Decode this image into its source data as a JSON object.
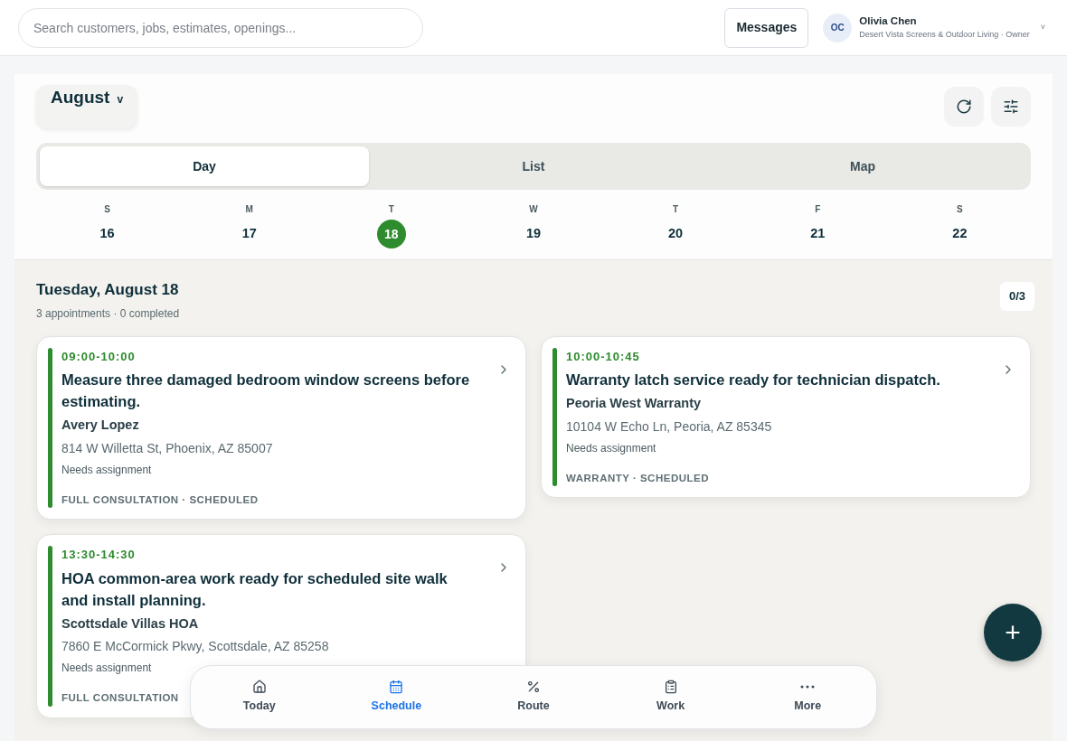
{
  "search": {
    "placeholder": "Search customers, jobs, estimates, openings..."
  },
  "header": {
    "messages": "Messages",
    "user": {
      "initials": "OC",
      "name": "Olivia Chen",
      "subtitle": "Desert Vista Screens & Outdoor Living · Owner",
      "caret": "˅"
    }
  },
  "month": {
    "label": "August",
    "caret": "v"
  },
  "views": [
    {
      "label": "Day",
      "selected": true
    },
    {
      "label": "List",
      "selected": false
    },
    {
      "label": "Map",
      "selected": false
    }
  ],
  "week": [
    {
      "weekday": "S",
      "date": "16",
      "selected": false
    },
    {
      "weekday": "M",
      "date": "17",
      "selected": false
    },
    {
      "weekday": "T",
      "date": "18",
      "selected": true
    },
    {
      "weekday": "W",
      "date": "19",
      "selected": false
    },
    {
      "weekday": "T",
      "date": "20",
      "selected": false
    },
    {
      "weekday": "F",
      "date": "21",
      "selected": false
    },
    {
      "weekday": "S",
      "date": "22",
      "selected": false
    }
  ],
  "day": {
    "title": "Tuesday, August 18",
    "summary": "3 appointments · 0 completed",
    "progress": "0/3"
  },
  "appointments": [
    {
      "time": "09:00-10:00",
      "title": "Measure three damaged bedroom window screens before estimating.",
      "client": "Avery Lopez",
      "address": "814 W Willetta St, Phoenix, AZ 85007",
      "note": "Needs assignment",
      "status": "FULL CONSULTATION · SCHEDULED",
      "color": "#2e8b2e"
    },
    {
      "time": "10:00-10:45",
      "title": "Warranty latch service ready for technician dispatch.",
      "client": "Peoria West Warranty",
      "address": "10104 W Echo Ln, Peoria, AZ 85345",
      "note": "Needs assignment",
      "status": "WARRANTY · SCHEDULED",
      "color": "#2e8b2e"
    },
    {
      "time": "13:30-14:30",
      "title": "HOA common-area work ready for scheduled site walk and install planning.",
      "client": "Scottsdale Villas HOA",
      "address": "7860 E McCormick Pkwy, Scottsdale, AZ 85258",
      "note": "Needs assignment",
      "status": "FULL CONSULTATION",
      "color": "#2e8b2e"
    }
  ],
  "nav": [
    {
      "label": "Today",
      "kind": "home",
      "selected": false
    },
    {
      "label": "Schedule",
      "kind": "calendar",
      "selected": true
    },
    {
      "label": "Route",
      "kind": "route",
      "selected": false
    },
    {
      "label": "Work",
      "kind": "clipboard",
      "selected": false
    },
    {
      "label": "More",
      "kind": "more",
      "selected": false
    }
  ],
  "fab": {
    "label": "+"
  }
}
